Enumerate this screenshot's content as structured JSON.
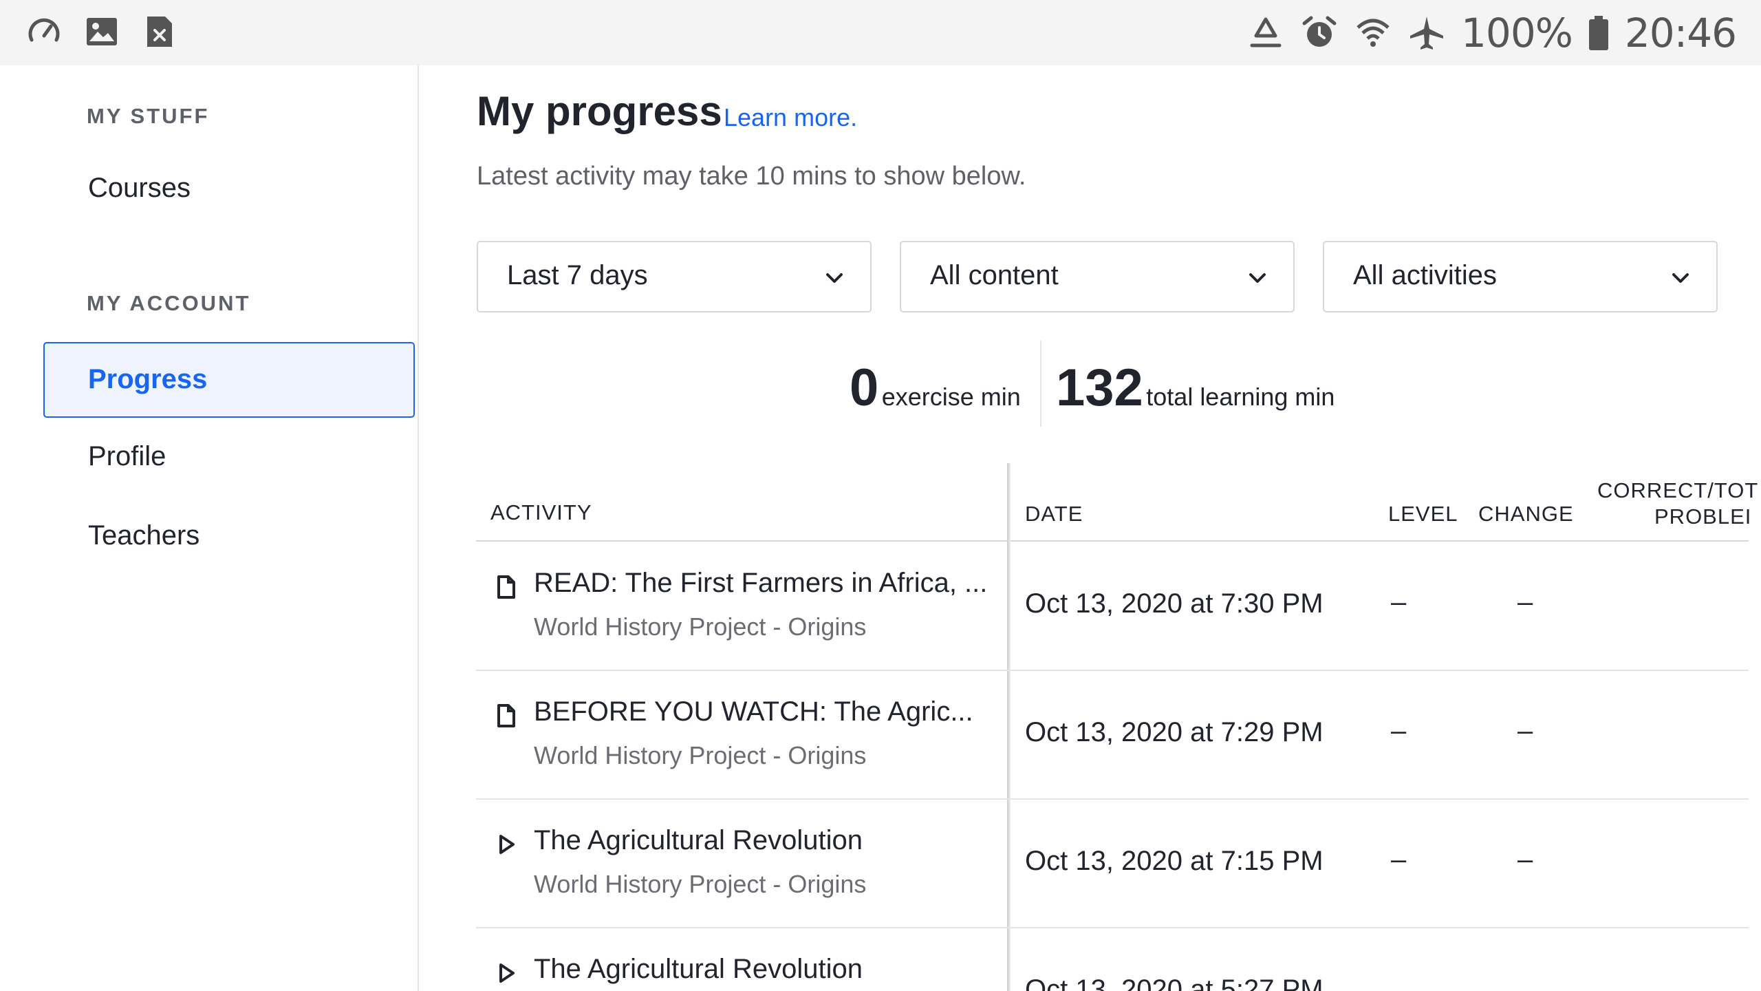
{
  "status_bar": {
    "battery_text": "100%",
    "time": "20:46",
    "left_icons": [
      "speedometer-icon",
      "image-icon",
      "file-close-icon"
    ],
    "right_icons": [
      "recycle-icon",
      "alarm-icon",
      "wifi-icon",
      "airplane-icon",
      "battery-icon"
    ]
  },
  "sidebar": {
    "section1_heading": "MY STUFF",
    "courses": "Courses",
    "section2_heading": "MY ACCOUNT",
    "progress": "Progress",
    "profile": "Profile",
    "teachers": "Teachers"
  },
  "main": {
    "title": "My progress",
    "learn_more": "Learn more.",
    "subtitle": "Latest activity may take 10 mins to show below.",
    "filters": {
      "time": "Last 7 days",
      "content": "All content",
      "activities": "All activities"
    },
    "stats": {
      "exercise_value": "0",
      "exercise_label": "exercise min",
      "total_value": "132",
      "total_label": "total learning min"
    },
    "table": {
      "headers": {
        "activity": "ACTIVITY",
        "date": "DATE",
        "level": "LEVEL",
        "change": "CHANGE",
        "correct_line1": "CORRECT/TOT",
        "correct_line2": "PROBLEI"
      },
      "rows": [
        {
          "icon": "article-icon",
          "title": "READ: The First Farmers in Africa, ...",
          "subtitle": "World History Project - Origins",
          "date": "Oct 13, 2020 at 7:30 PM",
          "level": "–",
          "change": "–"
        },
        {
          "icon": "article-icon",
          "title": "BEFORE YOU WATCH: The Agric...",
          "subtitle": "World History Project - Origins",
          "date": "Oct 13, 2020 at 7:29 PM",
          "level": "–",
          "change": "–"
        },
        {
          "icon": "video-play-icon",
          "title": "The Agricultural Revolution",
          "subtitle": "World History Project - Origins",
          "date": "Oct 13, 2020 at 7:15 PM",
          "level": "–",
          "change": "–"
        },
        {
          "icon": "video-play-icon",
          "title": "The Agricultural Revolution",
          "subtitle": "",
          "date": "Oct 13, 2020 at 5:27 PM",
          "level": "",
          "change": ""
        }
      ]
    }
  }
}
